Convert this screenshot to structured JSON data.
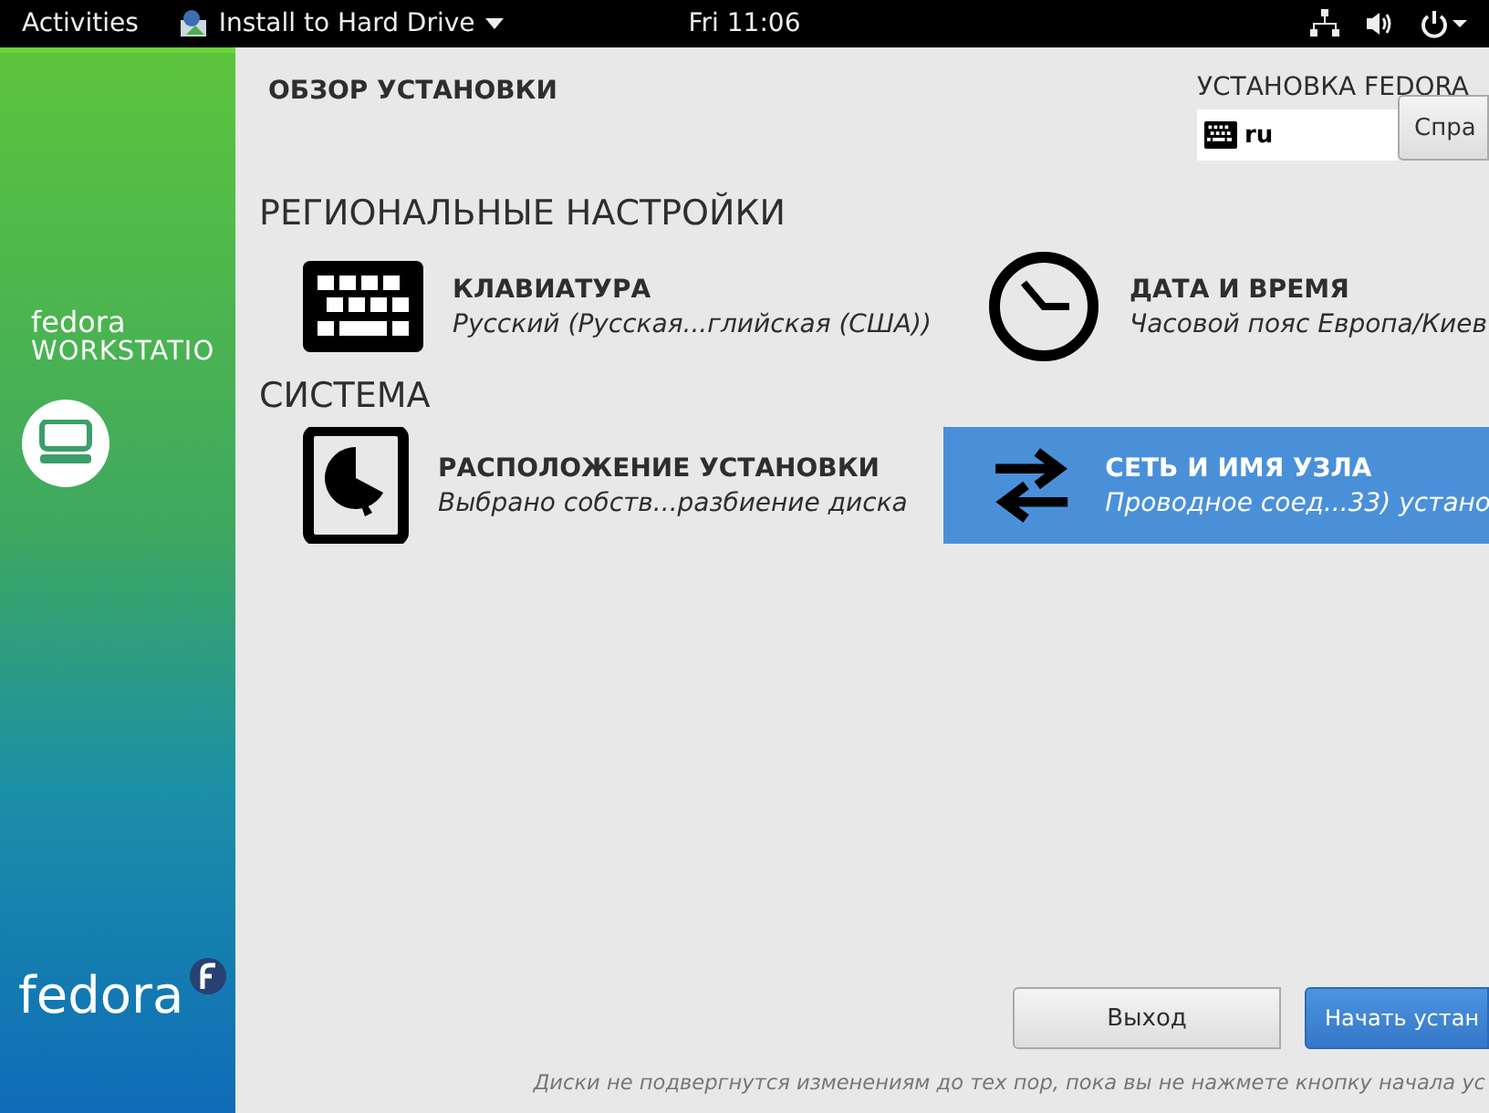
{
  "top_bar": {
    "activities": "Activities",
    "app_menu": "Install to Hard Drive",
    "clock": "Fri 11:06"
  },
  "sidebar": {
    "brand": "fedora",
    "product": "WORKSTATIO",
    "footer_logo": "fedora"
  },
  "header": {
    "title": "ОБЗОР УСТАНОВКИ",
    "product_title": "УСТАНОВКА FEDORA",
    "keyboard_layout": "ru",
    "help_button": "Спра"
  },
  "sections": [
    {
      "title": "РЕГИОНАЛЬНЫЕ НАСТРОЙКИ",
      "items": [
        {
          "kind": "keyboard",
          "title": "КЛАВИАТУРА",
          "status": "Русский (Русская...глийская (США))",
          "selected": false
        },
        {
          "kind": "clock",
          "title": "ДАТА И ВРЕМЯ",
          "status": "Часовой пояс Европа/Киев",
          "selected": false
        }
      ]
    },
    {
      "title": "СИСТЕМА",
      "items": [
        {
          "kind": "disk",
          "title": "РАСПОЛОЖЕНИЕ УСТАНОВКИ",
          "status": "Выбрано собств...разбиение диска",
          "selected": false
        },
        {
          "kind": "network",
          "title": "СЕТЬ И ИМЯ УЗЛА",
          "status": "Проводное соед...33) устано",
          "selected": true
        }
      ]
    }
  ],
  "buttons": [
    {
      "label": "Выход",
      "kind": "secondary"
    },
    {
      "label": "Начать устан",
      "kind": "primary"
    }
  ],
  "footer_note": "Диски не подвергнутся изменениям до тех пор, пока вы не нажмете кнопку начала ус"
}
